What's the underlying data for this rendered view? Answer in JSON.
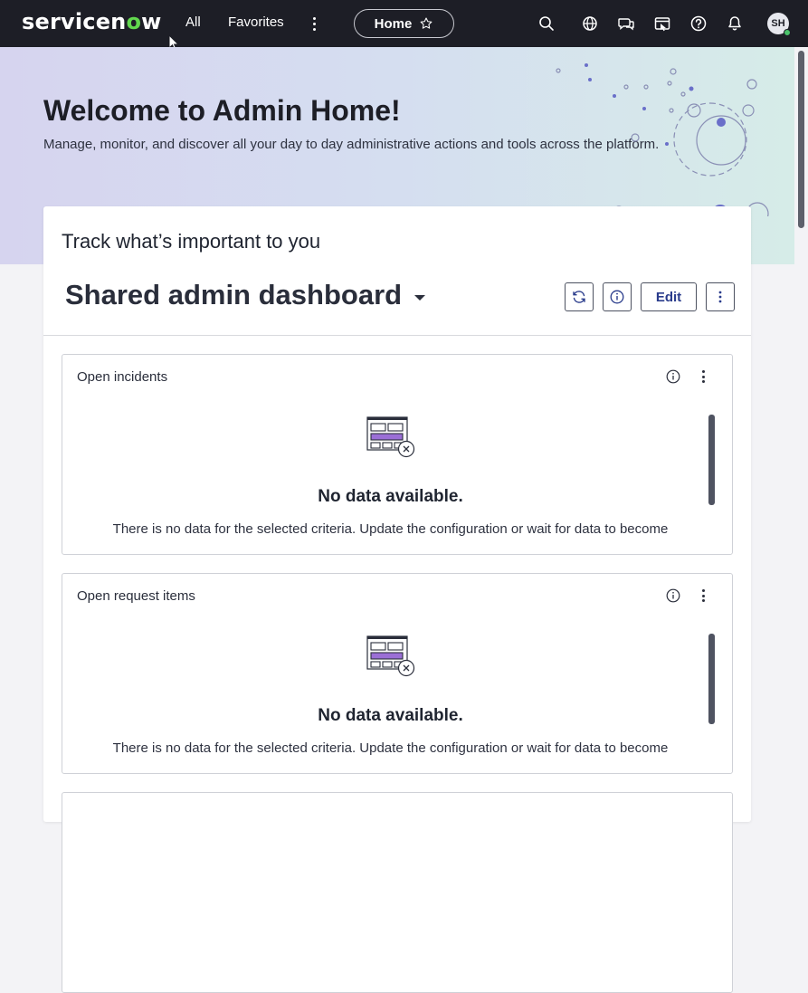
{
  "nav": {
    "logo_part1": "servicen",
    "logo_o": "o",
    "logo_part2": "w",
    "all": "All",
    "favorites": "Favorites",
    "home_tab": "Home",
    "icons": [
      "search-icon",
      "globe-icon",
      "chat-icon",
      "workspace-icon",
      "help-icon",
      "bell-icon"
    ],
    "avatar": "SH"
  },
  "banner": {
    "title": "Welcome to Admin Home!",
    "subtitle": "Manage, monitor, and discover all your day to day administrative actions and tools across the platform."
  },
  "card": {
    "title": "Track what’s important to you",
    "dashboard_name": "Shared admin dashboard",
    "edit_label": "Edit"
  },
  "widgets": [
    {
      "title": "Open incidents",
      "empty_title": "No data available.",
      "empty_text": "There is no data for the selected criteria. Update the configuration or wait for data to become"
    },
    {
      "title": "Open request items",
      "empty_title": "No data available.",
      "empty_text": "There is no data for the selected criteria. Update the configuration or wait for data to become"
    }
  ],
  "colors": {
    "nav_bg": "#1d1e26",
    "logo_accent": "#62d84e",
    "edit_text": "#2a3c8c",
    "empty_bar": "#9b6fd6"
  }
}
